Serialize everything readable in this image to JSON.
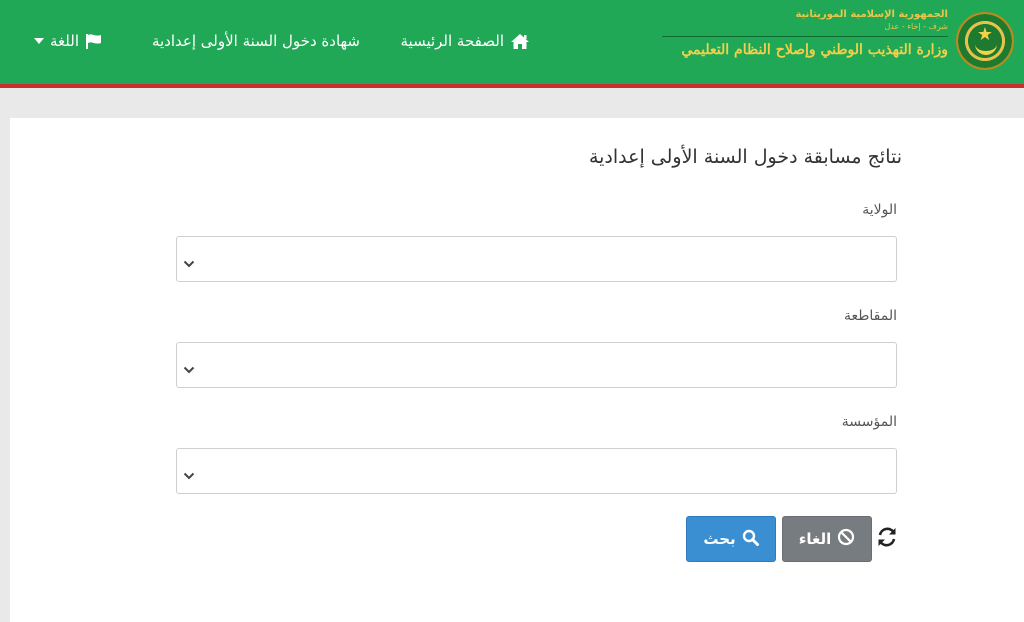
{
  "header": {
    "republic_name": "الجمهورية الإسلامية الموريتانية",
    "motto": "شرف - إخاء - عدل",
    "ministry_name": "وزارة التهذيب الوطني وإصلاح النظام التعليمي",
    "brand_color": "#20a856",
    "accent_bar_color": "#c9302c"
  },
  "nav": {
    "home_label": "الصفحة الرئيسية",
    "home_icon": "home-icon",
    "certificate_label": "شهادة دخول السنة الأولى إعدادية",
    "language_label": "اللغة",
    "language_icon": "flag-icon"
  },
  "form": {
    "title": "نتائج مسابقة دخول السنة الأولى إعدادية",
    "fields": [
      {
        "label": "الولاية",
        "value": ""
      },
      {
        "label": "المقاطعة",
        "value": ""
      },
      {
        "label": "المؤسسة",
        "value": ""
      }
    ],
    "search_label": "بحث",
    "search_icon": "search-icon",
    "search_color": "#3a8fd3",
    "cancel_label": "الغاء",
    "cancel_icon": "ban-icon",
    "cancel_color": "#777c80",
    "refresh_icon": "refresh-icon"
  }
}
